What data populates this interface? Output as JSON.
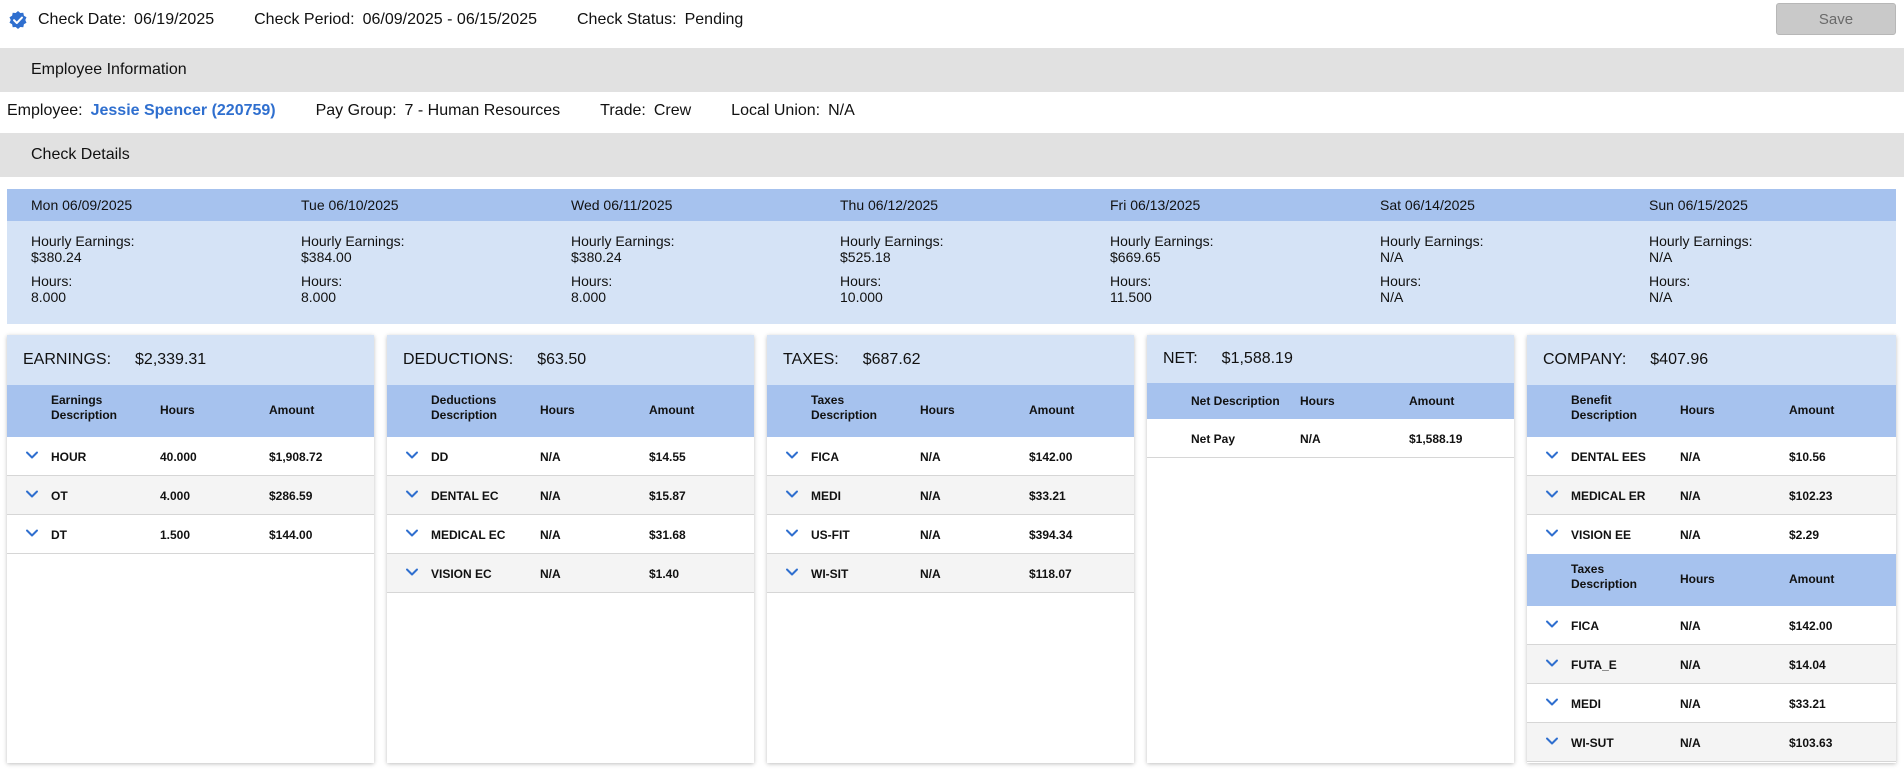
{
  "header": {
    "check_date_label": "Check Date:",
    "check_date": "06/19/2025",
    "check_period_label": "Check Period:",
    "check_period": "06/09/2025 - 06/15/2025",
    "check_status_label": "Check Status:",
    "check_status": "Pending",
    "save_label": "Save"
  },
  "employee_section": {
    "title": "Employee Information",
    "employee_label": "Employee:",
    "employee": "Jessie Spencer (220759)",
    "pay_group_label": "Pay Group:",
    "pay_group": "7 - Human Resources",
    "trade_label": "Trade:",
    "trade": "Crew",
    "local_union_label": "Local Union:",
    "local_union": "N/A"
  },
  "check_details": {
    "title": "Check Details"
  },
  "days": [
    {
      "date": "Mon 06/09/2025",
      "earn_label": "Hourly Earnings:",
      "earnings": "$380.24",
      "hours_label": "Hours:",
      "hours": "8.000"
    },
    {
      "date": "Tue 06/10/2025",
      "earn_label": "Hourly Earnings:",
      "earnings": "$384.00",
      "hours_label": "Hours:",
      "hours": "8.000"
    },
    {
      "date": "Wed 06/11/2025",
      "earn_label": "Hourly Earnings:",
      "earnings": "$380.24",
      "hours_label": "Hours:",
      "hours": "8.000"
    },
    {
      "date": "Thu 06/12/2025",
      "earn_label": "Hourly Earnings:",
      "earnings": "$525.18",
      "hours_label": "Hours:",
      "hours": "10.000"
    },
    {
      "date": "Fri 06/13/2025",
      "earn_label": "Hourly Earnings:",
      "earnings": "$669.65",
      "hours_label": "Hours:",
      "hours": "11.500"
    },
    {
      "date": "Sat 06/14/2025",
      "earn_label": "Hourly Earnings:",
      "earnings": "N/A",
      "hours_label": "Hours:",
      "hours": "N/A"
    },
    {
      "date": "Sun 06/15/2025",
      "earn_label": "Hourly Earnings:",
      "earnings": "N/A",
      "hours_label": "Hours:",
      "hours": "N/A"
    }
  ],
  "earnings": {
    "label": "EARNINGS:",
    "total": "$2,339.31",
    "col_desc": "Earnings Description",
    "col_hours": "Hours",
    "col_amount": "Amount",
    "rows": [
      {
        "desc": "HOUR",
        "hours": "40.000",
        "amount": "$1,908.72"
      },
      {
        "desc": "OT",
        "hours": "4.000",
        "amount": "$286.59"
      },
      {
        "desc": "DT",
        "hours": "1.500",
        "amount": "$144.00"
      }
    ]
  },
  "deductions": {
    "label": "DEDUCTIONS:",
    "total": "$63.50",
    "col_desc": "Deductions Description",
    "col_hours": "Hours",
    "col_amount": "Amount",
    "rows": [
      {
        "desc": "DD",
        "hours": "N/A",
        "amount": "$14.55"
      },
      {
        "desc": "DENTAL EC",
        "hours": "N/A",
        "amount": "$15.87"
      },
      {
        "desc": "MEDICAL EC",
        "hours": "N/A",
        "amount": "$31.68"
      },
      {
        "desc": "VISION EC",
        "hours": "N/A",
        "amount": "$1.40"
      }
    ]
  },
  "taxes": {
    "label": "TAXES:",
    "total": "$687.62",
    "col_desc": "Taxes Description",
    "col_hours": "Hours",
    "col_amount": "Amount",
    "rows": [
      {
        "desc": "FICA",
        "hours": "N/A",
        "amount": "$142.00"
      },
      {
        "desc": "MEDI",
        "hours": "N/A",
        "amount": "$33.21"
      },
      {
        "desc": "US-FIT",
        "hours": "N/A",
        "amount": "$394.34"
      },
      {
        "desc": "WI-SIT",
        "hours": "N/A",
        "amount": "$118.07"
      }
    ]
  },
  "net": {
    "label": "NET:",
    "total": "$1,588.19",
    "col_desc": "Net Description",
    "col_hours": "Hours",
    "col_amount": "Amount",
    "rows": [
      {
        "desc": "Net Pay",
        "hours": "N/A",
        "amount": "$1,588.19"
      }
    ]
  },
  "company": {
    "label": "COMPANY:",
    "total": "$407.96",
    "col_desc": "Benefit Description",
    "col_hours": "Hours",
    "col_amount": "Amount",
    "rows": [
      {
        "desc": "DENTAL EES",
        "hours": "N/A",
        "amount": "$10.56"
      },
      {
        "desc": "MEDICAL ER",
        "hours": "N/A",
        "amount": "$102.23"
      },
      {
        "desc": "VISION EE",
        "hours": "N/A",
        "amount": "$2.29"
      }
    ],
    "tax_col_desc": "Taxes Description",
    "tax_col_hours": "Hours",
    "tax_col_amount": "Amount",
    "tax_rows": [
      {
        "desc": "FICA",
        "hours": "N/A",
        "amount": "$142.00"
      },
      {
        "desc": "FUTA_E",
        "hours": "N/A",
        "amount": "$14.04"
      },
      {
        "desc": "MEDI",
        "hours": "N/A",
        "amount": "$33.21"
      },
      {
        "desc": "WI-SUT",
        "hours": "N/A",
        "amount": "$103.63"
      }
    ]
  },
  "colors": {
    "accent": "#2f6fcf",
    "header_blue": "#a6c2ee",
    "light_blue": "#d5e3f6",
    "section_gray": "#e1e1e1"
  }
}
